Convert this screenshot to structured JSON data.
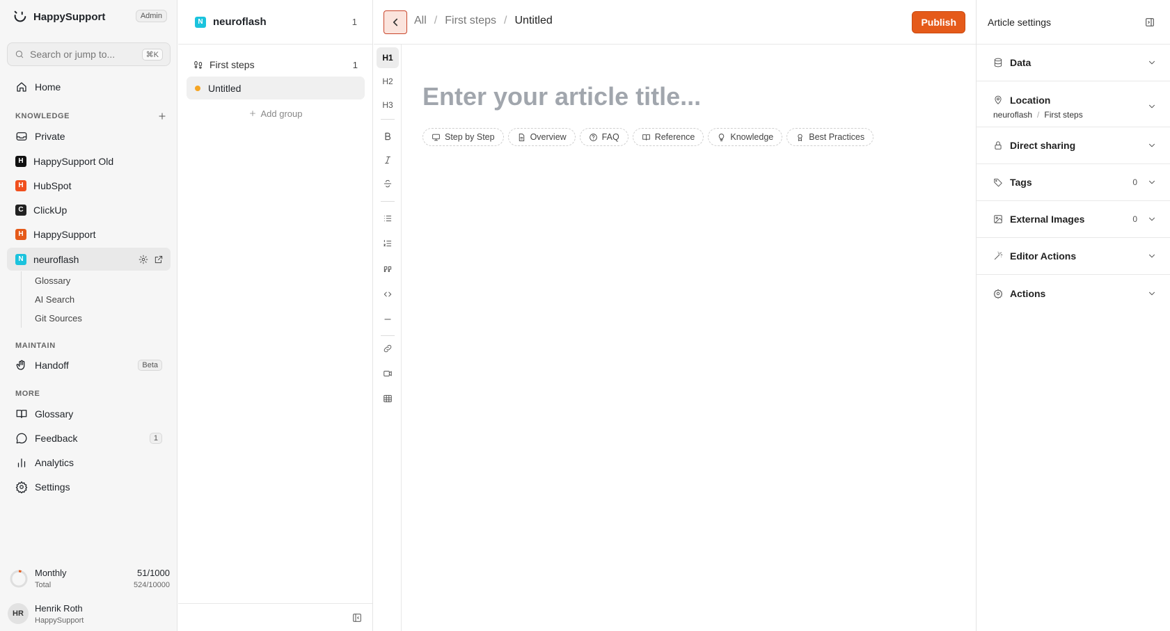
{
  "app": {
    "name": "HappySupport",
    "role_badge": "Admin"
  },
  "search": {
    "placeholder": "Search or jump to...",
    "shortcut": "⌘K"
  },
  "nav": {
    "home": "Home"
  },
  "knowledge": {
    "label": "KNOWLEDGE",
    "items": [
      {
        "label": "Private",
        "icon": "inbox-icon"
      },
      {
        "label": "HappySupport Old",
        "badge": "H",
        "color": "#111111"
      },
      {
        "label": "HubSpot",
        "badge": "H",
        "color": "#f0501e"
      },
      {
        "label": "ClickUp",
        "badge": "C",
        "color": "#222222"
      },
      {
        "label": "HappySupport",
        "badge": "H",
        "color": "#e55a1a"
      },
      {
        "label": "neuroflash",
        "badge": "N",
        "color": "#1bc3dd"
      }
    ],
    "sub_items": [
      "Glossary",
      "AI Search",
      "Git Sources"
    ]
  },
  "maintain": {
    "label": "MAINTAIN",
    "handoff": "Handoff",
    "handoff_badge": "Beta"
  },
  "more": {
    "label": "MORE",
    "items": [
      {
        "label": "Glossary"
      },
      {
        "label": "Feedback",
        "count": "1"
      },
      {
        "label": "Analytics"
      },
      {
        "label": "Settings"
      }
    ]
  },
  "usage": {
    "label": "Monthly",
    "sublabel": "Total",
    "value": "51/1000",
    "total": "524/10000",
    "progress": 0.051
  },
  "user": {
    "initials": "HR",
    "name": "Henrik Roth",
    "org": "HappySupport"
  },
  "tree": {
    "title": "neuroflash",
    "badge": "N",
    "count": "1",
    "group": {
      "label": "First steps",
      "count": "1"
    },
    "article": "Untitled",
    "add_group": "Add group"
  },
  "editor": {
    "breadcrumb": [
      "All",
      "First steps",
      "Untitled"
    ],
    "publish": "Publish",
    "title_placeholder": "Enter your article title...",
    "templates": [
      "Step by Step",
      "Overview",
      "FAQ",
      "Reference",
      "Knowledge",
      "Best Practices"
    ],
    "tools": {
      "h1": "H1",
      "h2": "H2",
      "h3": "H3",
      "bold": "B"
    }
  },
  "settings": {
    "title": "Article settings",
    "sections": [
      {
        "label": "Data"
      },
      {
        "label": "Location",
        "path": [
          "neuroflash",
          "First steps"
        ]
      },
      {
        "label": "Direct sharing"
      },
      {
        "label": "Tags",
        "count": "0"
      },
      {
        "label": "External Images",
        "count": "0"
      },
      {
        "label": "Editor Actions"
      },
      {
        "label": "Actions"
      }
    ]
  },
  "colors": {
    "accent": "#e55a1a",
    "active_dot": "#f5a524"
  }
}
